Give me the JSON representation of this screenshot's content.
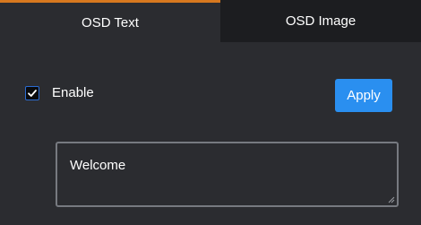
{
  "tabs": [
    {
      "label": "OSD Text",
      "active": true
    },
    {
      "label": "OSD Image",
      "active": false
    }
  ],
  "enable": {
    "label": "Enable",
    "checked": true
  },
  "apply_button": {
    "label": "Apply"
  },
  "osd_text": {
    "value": "Welcome"
  },
  "colors": {
    "accent": "#2a8ff0",
    "active_tab_indicator": "#d7781f",
    "panel_bg": "#2b2c30",
    "tab_bar_bg": "#1c1d20"
  },
  "icons": {
    "checkbox": "check-icon",
    "resize": "resize-handle-icon"
  }
}
